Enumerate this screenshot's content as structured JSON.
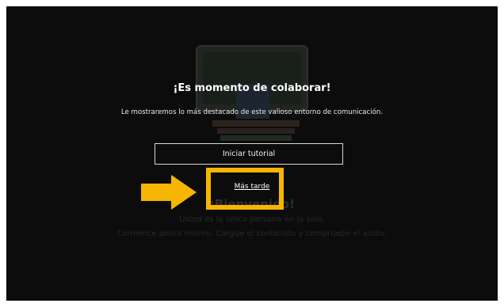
{
  "background": {
    "welcome": "¡Bienvenido!",
    "line1": "Usted es la única persona en la sala.",
    "line2": "Comience ahora mismo. Cargue el contenido y compruebe el audio."
  },
  "dialog": {
    "title": "¡Es momento de colaborar!",
    "description": "Le mostraremos lo más destacado de este valioso entorno de comunicación.",
    "start_tutorial_label": "Iniciar tutorial",
    "later_label": "Más tarde"
  },
  "annotation": {
    "color": "#f6b500",
    "arrow_icon": "arrow-right-icon"
  }
}
